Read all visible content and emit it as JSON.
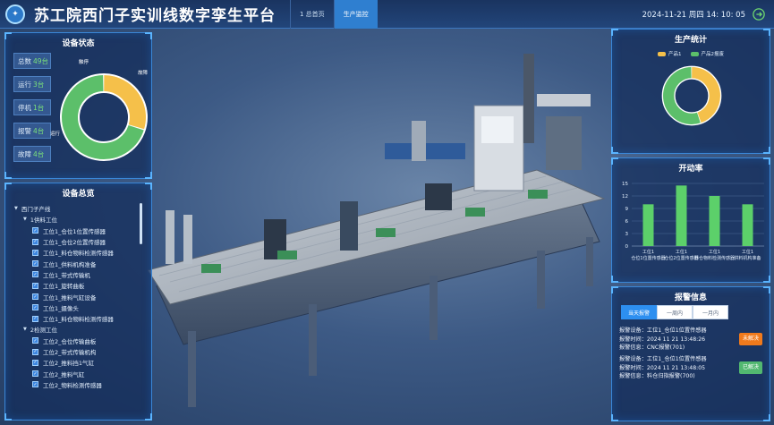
{
  "header": {
    "title": "苏工院西门子实训线数字孪生平台",
    "nav_tabs": [
      {
        "label": "1 总首页"
      },
      {
        "label": "生产监控",
        "active": true
      }
    ],
    "datetime": "2024-11-21 周四 14: 10: 05"
  },
  "device_status": {
    "title": "设备状态",
    "items": [
      {
        "label": "总数",
        "value": "49台"
      },
      {
        "label": "运行",
        "value": "3台"
      },
      {
        "label": "停机",
        "value": "1台"
      },
      {
        "label": "报警",
        "value": "4台"
      },
      {
        "label": "故障",
        "value": "4台"
      }
    ],
    "donut_labels": [
      "触停",
      "故障",
      "运行"
    ],
    "donut": [
      {
        "label": "运行",
        "value": 30,
        "color": "#f5c04a"
      },
      {
        "label": "停机",
        "value": 70,
        "color": "#5cbf6a"
      }
    ]
  },
  "equipment_tree": {
    "title": "设备总览",
    "rows": [
      {
        "text": "西门子产线",
        "level": 0,
        "caret": "▼",
        "check": false
      },
      {
        "text": "1供料工位",
        "level": 1,
        "caret": "▼",
        "check": false
      },
      {
        "text": "工位1_仓位1位置传感器",
        "level": 2,
        "check": true
      },
      {
        "text": "工位1_仓位2位置传感器",
        "level": 2,
        "check": true
      },
      {
        "text": "工位1_料仓物料检测传感器",
        "level": 2,
        "check": true
      },
      {
        "text": "工位1_供料机构准备",
        "level": 2,
        "check": true
      },
      {
        "text": "工位1_带式传输机",
        "level": 2,
        "check": true
      },
      {
        "text": "工位1_旋转曲板",
        "level": 2,
        "check": true
      },
      {
        "text": "工位1_推料气缸设备",
        "level": 2,
        "check": true
      },
      {
        "text": "工位1_摄像头",
        "level": 2,
        "check": true
      },
      {
        "text": "工位1_料仓物料检测传感器",
        "level": 2,
        "check": true
      },
      {
        "text": "2检测工位",
        "level": 1,
        "caret": "▼",
        "check": false
      },
      {
        "text": "工位2_仓位传输曲板",
        "level": 2,
        "check": true
      },
      {
        "text": "工位2_带式传输机构",
        "level": 2,
        "check": true
      },
      {
        "text": "工位2_推料挡1气缸",
        "level": 2,
        "check": true
      },
      {
        "text": "工位2_推料气缸",
        "level": 2,
        "check": true
      },
      {
        "text": "工位2_物料检测传感器",
        "level": 2,
        "check": true
      }
    ]
  },
  "production": {
    "title": "生产统计",
    "legend": [
      {
        "label": "产品1",
        "color": "#f5c04a"
      },
      {
        "label": "产品2报废",
        "color": "#5cbf6a"
      }
    ],
    "donut": [
      {
        "label": "产品1",
        "value": 45,
        "color": "#f5c04a"
      },
      {
        "label": "产品2报废",
        "value": 55,
        "color": "#5cbf6a"
      }
    ]
  },
  "chart_data": {
    "type": "bar",
    "title": "开动率",
    "categories": [
      "工位1 仓位1位置传感器",
      "工位1 仓位2位置传感器",
      "工位1 料仓物料检测传感器",
      "工位1 供料机构准备"
    ],
    "values": [
      10,
      14.5,
      12,
      10
    ],
    "ylim": [
      0,
      15
    ],
    "yticks": [
      0,
      3,
      6,
      9,
      12,
      15
    ],
    "xlabel": "",
    "ylabel": "",
    "grid": true,
    "color": "#5cd06a"
  },
  "alarm": {
    "title": "报警信息",
    "tabs": [
      {
        "label": "当天报警",
        "active": true
      },
      {
        "label": "一周内"
      },
      {
        "label": "一月内"
      }
    ],
    "items": [
      {
        "device": "报警设备：工位1_仓位1位置传感器",
        "time": "报警时间：2024 11 21 13:48:26",
        "info": "报警信息：CNC报警(701)",
        "status": "未解决",
        "status_color": "#f07a1c"
      },
      {
        "device": "报警设备：工位1_仓位1位置传感器",
        "time": "报警时间：2024 11 21 13:48:05",
        "info": "报警信息：料仓归指报警(700)",
        "status": "已解决",
        "status_color": "#52b870"
      }
    ]
  }
}
